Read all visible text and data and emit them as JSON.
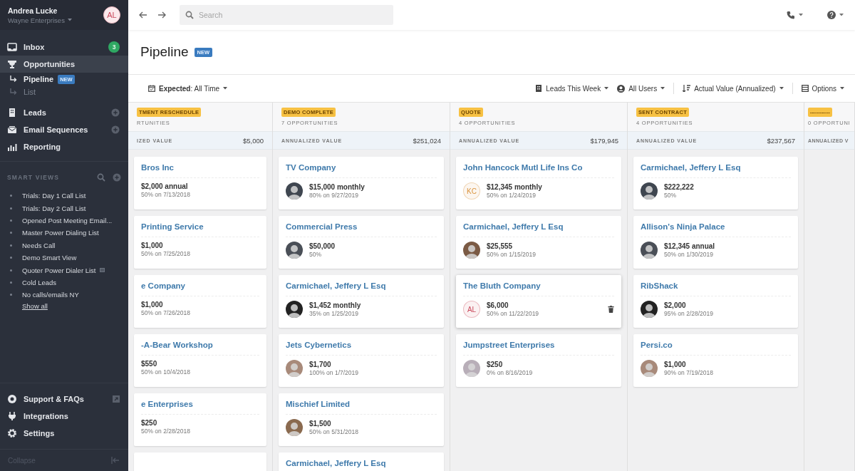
{
  "sidebar": {
    "user": {
      "name": "Andrea Lucke",
      "org": "Wayne Enterprises",
      "initials": "AL"
    },
    "nav": [
      {
        "label": "Inbox",
        "badge": "3",
        "selected": false
      },
      {
        "label": "Opportunities",
        "selected": true,
        "children": [
          {
            "label": "Pipeline",
            "badge": "NEW",
            "selected": true
          },
          {
            "label": "List",
            "selected": false
          }
        ]
      },
      {
        "label": "Leads",
        "addable": true,
        "selected": false
      },
      {
        "label": "Email Sequences",
        "addable": true,
        "selected": false
      },
      {
        "label": "Reporting",
        "selected": false
      }
    ],
    "smart_views": {
      "title": "SMART VIEWS",
      "items": [
        {
          "label": "Trials: Day 1 Call List"
        },
        {
          "label": "Trials: Day 2 Call List"
        },
        {
          "label": "Opened Post Meeting Email..."
        },
        {
          "label": "Master Power Dialing List"
        },
        {
          "label": "Needs Call"
        },
        {
          "label": "Demo Smart View"
        },
        {
          "label": "Quoter Power Dialer List",
          "shared": true
        },
        {
          "label": "Cold Leads"
        },
        {
          "label": "No calls/emails NY"
        }
      ],
      "show_all": "Show all"
    },
    "footer": [
      {
        "label": "Support & FAQs",
        "external": true
      },
      {
        "label": "Integrations"
      },
      {
        "label": "Settings"
      }
    ],
    "collapse": "Collapse"
  },
  "topbar": {
    "search": {
      "placeholder": "Search"
    }
  },
  "page": {
    "title": "Pipeline",
    "badge": "NEW"
  },
  "filters": {
    "left": [
      {
        "label": "**Expected**: All Time"
      }
    ],
    "right": [
      {
        "label": "Leads This Week"
      },
      {
        "label": "All Users"
      },
      {
        "label": "Actual Value (Annualized)"
      },
      {
        "label": "Options"
      }
    ]
  },
  "columns": [
    {
      "stage": "TMENT RESCHEDULE",
      "count": "RTUNITIES",
      "value_label": "IZED VALUE",
      "value": "$5,000",
      "cards": [
        {
          "name": "Bros Inc",
          "amount": "$2,000 annual",
          "detail": "50% on 7/13/2018"
        },
        {
          "name": "Printing Service",
          "amount": "$1,000",
          "detail": "50% on 7/25/2018"
        },
        {
          "name": "e Company",
          "amount": "$1,000",
          "detail": "50% on 7/26/2018"
        },
        {
          "name": "-A-Bear Workshop",
          "amount": "$550",
          "detail": "50% on 10/4/2018"
        },
        {
          "name": "e Enterprises",
          "amount": "$250",
          "detail": "50% on 2/28/2018"
        },
        {
          "kind": "stub"
        }
      ]
    },
    {
      "stage": "DEMO COMPLETE",
      "count": "7 OPPORTUNITIES",
      "value_label": "ANNUALIZED VALUE",
      "value": "$251,024",
      "cards": [
        {
          "name": "TV Company",
          "amount": "$15,000 monthly",
          "detail": "80% on 9/27/2019",
          "avatar": {
            "kind": "photo"
          }
        },
        {
          "name": "Commercial Press",
          "amount": "$50,000",
          "detail": "50%",
          "avatar": {
            "kind": "photo"
          }
        },
        {
          "name": "Carmichael, Jeffery L Esq",
          "amount": "$1,452 monthly",
          "detail": "35% on 1/25/2019",
          "avatar": {
            "kind": "photo"
          }
        },
        {
          "name": "Jets Cybernetics",
          "amount": "$1,700",
          "detail": "100% on 1/7/2019",
          "avatar": {
            "kind": "photo"
          }
        },
        {
          "name": "Mischief Limited",
          "amount": "$1,500",
          "detail": "50% on 5/31/2018",
          "avatar": {
            "kind": "photo"
          }
        },
        {
          "kind": "stub",
          "name": "Carmichael, Jeffery L Esq"
        }
      ]
    },
    {
      "stage": "QUOTE",
      "count": "4 OPPORTUNITIES",
      "value_label": "ANNUALIZED VALUE",
      "value": "$179,945",
      "cards": [
        {
          "name": "John Hancock Mutl Life Ins Co",
          "amount": "$12,345 monthly",
          "detail": "50% on 1/24/2019",
          "avatar": {
            "kind": "initials",
            "text": "KC",
            "color": "#d9923a"
          }
        },
        {
          "name": "Carmichael, Jeffery L Esq",
          "amount": "$25,555",
          "detail": "50% on 1/15/2019",
          "avatar": {
            "kind": "photo"
          }
        },
        {
          "name": "The Bluth Company",
          "amount": "$6,000",
          "detail": "50% on 11/22/2019",
          "avatar": {
            "kind": "initials",
            "text": "AL",
            "color": "#c9485b"
          },
          "hovered": true
        },
        {
          "name": "Jumpstreet Enterprises",
          "amount": "$250",
          "detail": "0% on 8/16/2019",
          "avatar": {
            "kind": "photo"
          }
        }
      ]
    },
    {
      "stage": "SENT CONTRACT",
      "count": "4 OPPORTUNITIES",
      "value_label": "ANNUALIZED VALUE",
      "value": "$237,567",
      "cards": [
        {
          "name": "Carmichael, Jeffery L Esq",
          "amount": "$222,222",
          "detail": "50%",
          "avatar": {
            "kind": "photo"
          }
        },
        {
          "name": "Allison's Ninja Palace",
          "amount": "$12,345 annual",
          "detail": "50% on 1/30/2019",
          "avatar": {
            "kind": "photo"
          }
        },
        {
          "name": "RibShack",
          "amount": "$2,000",
          "detail": "95% on 2/28/2019",
          "avatar": {
            "kind": "photo"
          }
        },
        {
          "name": "Persi.co",
          "amount": "$1,000",
          "detail": "90% on 7/19/2018",
          "avatar": {
            "kind": "photo"
          }
        }
      ]
    },
    {
      "stage": "----------",
      "count": "0 OPPORTUNI",
      "value_label": "ANNUALIZED V"
    }
  ]
}
